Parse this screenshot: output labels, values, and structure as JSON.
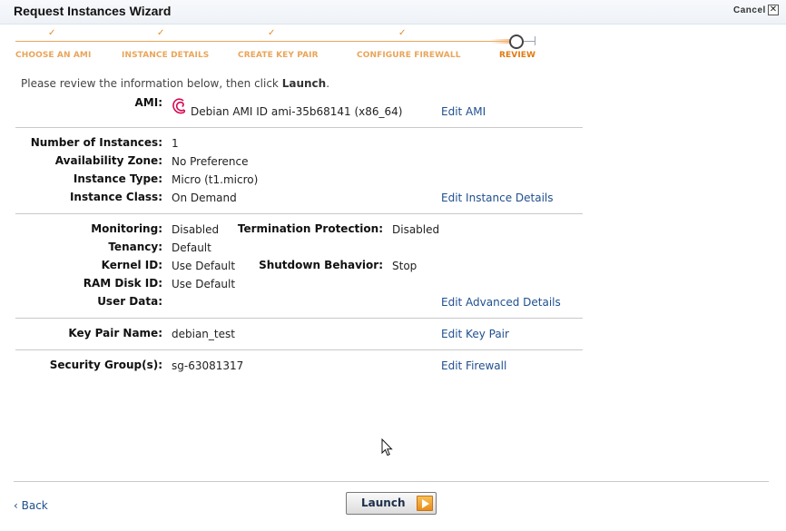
{
  "window": {
    "title": "Request Instances Wizard",
    "cancel_label": "Cancel",
    "close_glyph": "✕"
  },
  "wizard": {
    "check_glyph": "✓",
    "steps": [
      {
        "label": "CHOOSE AN AMI",
        "state": "done"
      },
      {
        "label": "INSTANCE DETAILS",
        "state": "done"
      },
      {
        "label": "CREATE KEY PAIR",
        "state": "done"
      },
      {
        "label": "CONFIGURE FIREWALL",
        "state": "done"
      },
      {
        "label": "REVIEW",
        "state": "current"
      }
    ]
  },
  "intro": {
    "prefix": "Please review the information below, then click ",
    "strong": "Launch",
    "suffix": "."
  },
  "ami": {
    "label": "AMI:",
    "value": "Debian AMI ID ami-35b68141 (x86_64)",
    "edit_label": "Edit AMI",
    "icon": "debian-logo-icon"
  },
  "instance": {
    "count_label": "Number of Instances:",
    "count_value": "1",
    "zone_label": "Availability Zone:",
    "zone_value": "No Preference",
    "type_label": "Instance Type:",
    "type_value": "Micro (t1.micro)",
    "class_label": "Instance Class:",
    "class_value": "On Demand",
    "edit_label": "Edit Instance Details"
  },
  "advanced": {
    "monitoring_label": "Monitoring:",
    "monitoring_value": "Disabled",
    "termination_label": "Termination Protection:",
    "termination_value": "Disabled",
    "tenancy_label": "Tenancy:",
    "tenancy_value": "Default",
    "kernel_label": "Kernel ID:",
    "kernel_value": "Use Default",
    "shutdown_label": "Shutdown Behavior:",
    "shutdown_value": "Stop",
    "ramdisk_label": "RAM Disk ID:",
    "ramdisk_value": "Use Default",
    "userdata_label": "User Data:",
    "userdata_value": "",
    "edit_label": "Edit Advanced Details"
  },
  "keypair": {
    "label": "Key Pair Name:",
    "value": "debian_test",
    "edit_label": "Edit Key Pair"
  },
  "security": {
    "label": "Security Group(s):",
    "value": "sg-63081317",
    "edit_label": "Edit Firewall"
  },
  "footer": {
    "back_label": "‹ Back",
    "launch_label": "Launch"
  },
  "colors": {
    "accent": "#e9a55a",
    "link": "#1f4f8f",
    "launch_arrow": "#f0a030"
  }
}
